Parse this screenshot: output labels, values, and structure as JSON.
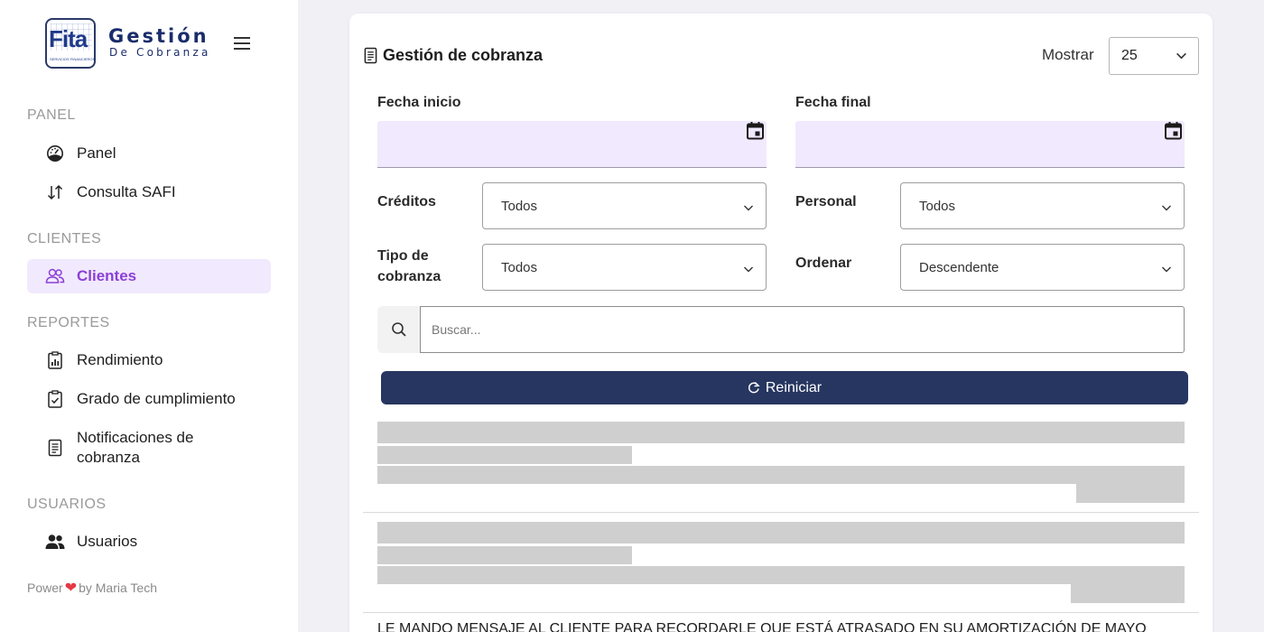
{
  "brand": {
    "logo_text": "Fita",
    "logo_subtext": "SERVICIOS FINANCIEROS",
    "title": "Gestión",
    "subtitle": "De Cobranza"
  },
  "sidebar": {
    "sections": [
      {
        "title": "PANEL"
      },
      {
        "title": "CLIENTES"
      },
      {
        "title": "REPORTES"
      },
      {
        "title": "USUARIOS"
      }
    ],
    "items": [
      {
        "label": "Panel",
        "icon": "dashboard-icon"
      },
      {
        "label": "Consulta SAFI",
        "icon": "sort-arrows-icon"
      },
      {
        "label": "Clientes",
        "icon": "users-icon",
        "active": true
      },
      {
        "label": "Rendimiento",
        "icon": "report-chart-icon"
      },
      {
        "label": "Grado de cumplimiento",
        "icon": "clipboard-check-icon"
      },
      {
        "label": "Notificaciones de cobranza",
        "icon": "document-icon"
      },
      {
        "label": "Usuarios",
        "icon": "people-icon"
      }
    ],
    "footer": {
      "prefix": "Power",
      "suffix": "by Maria Tech"
    }
  },
  "main": {
    "title": "Gestión de cobranza",
    "mostrar_label": "Mostrar",
    "mostrar_value": "25",
    "filters": {
      "fecha_inicio_label": "Fecha inicio",
      "fecha_final_label": "Fecha final",
      "creditos_label": "Créditos",
      "creditos_value": "Todos",
      "personal_label": "Personal",
      "personal_value": "Todos",
      "tipo_cobranza_label": "Tipo de cobranza",
      "tipo_cobranza_value": "Todos",
      "ordenar_label": "Ordenar",
      "ordenar_value": "Descendente"
    },
    "search_placeholder": "Buscar...",
    "reset_label": "Reiniciar",
    "message": "LE MANDO MENSAJE AL CLIENTE PARA RECORDARLE QUE ESTÁ ATRASADO EN SU AMORTIZACIÓN DE MAYO"
  },
  "colors": {
    "accent": "#8b3fd6",
    "primary_button": "#263660",
    "date_input_bg": "#f1e9fd",
    "skeleton": "#cfcfcf",
    "heart": "#e53946"
  }
}
